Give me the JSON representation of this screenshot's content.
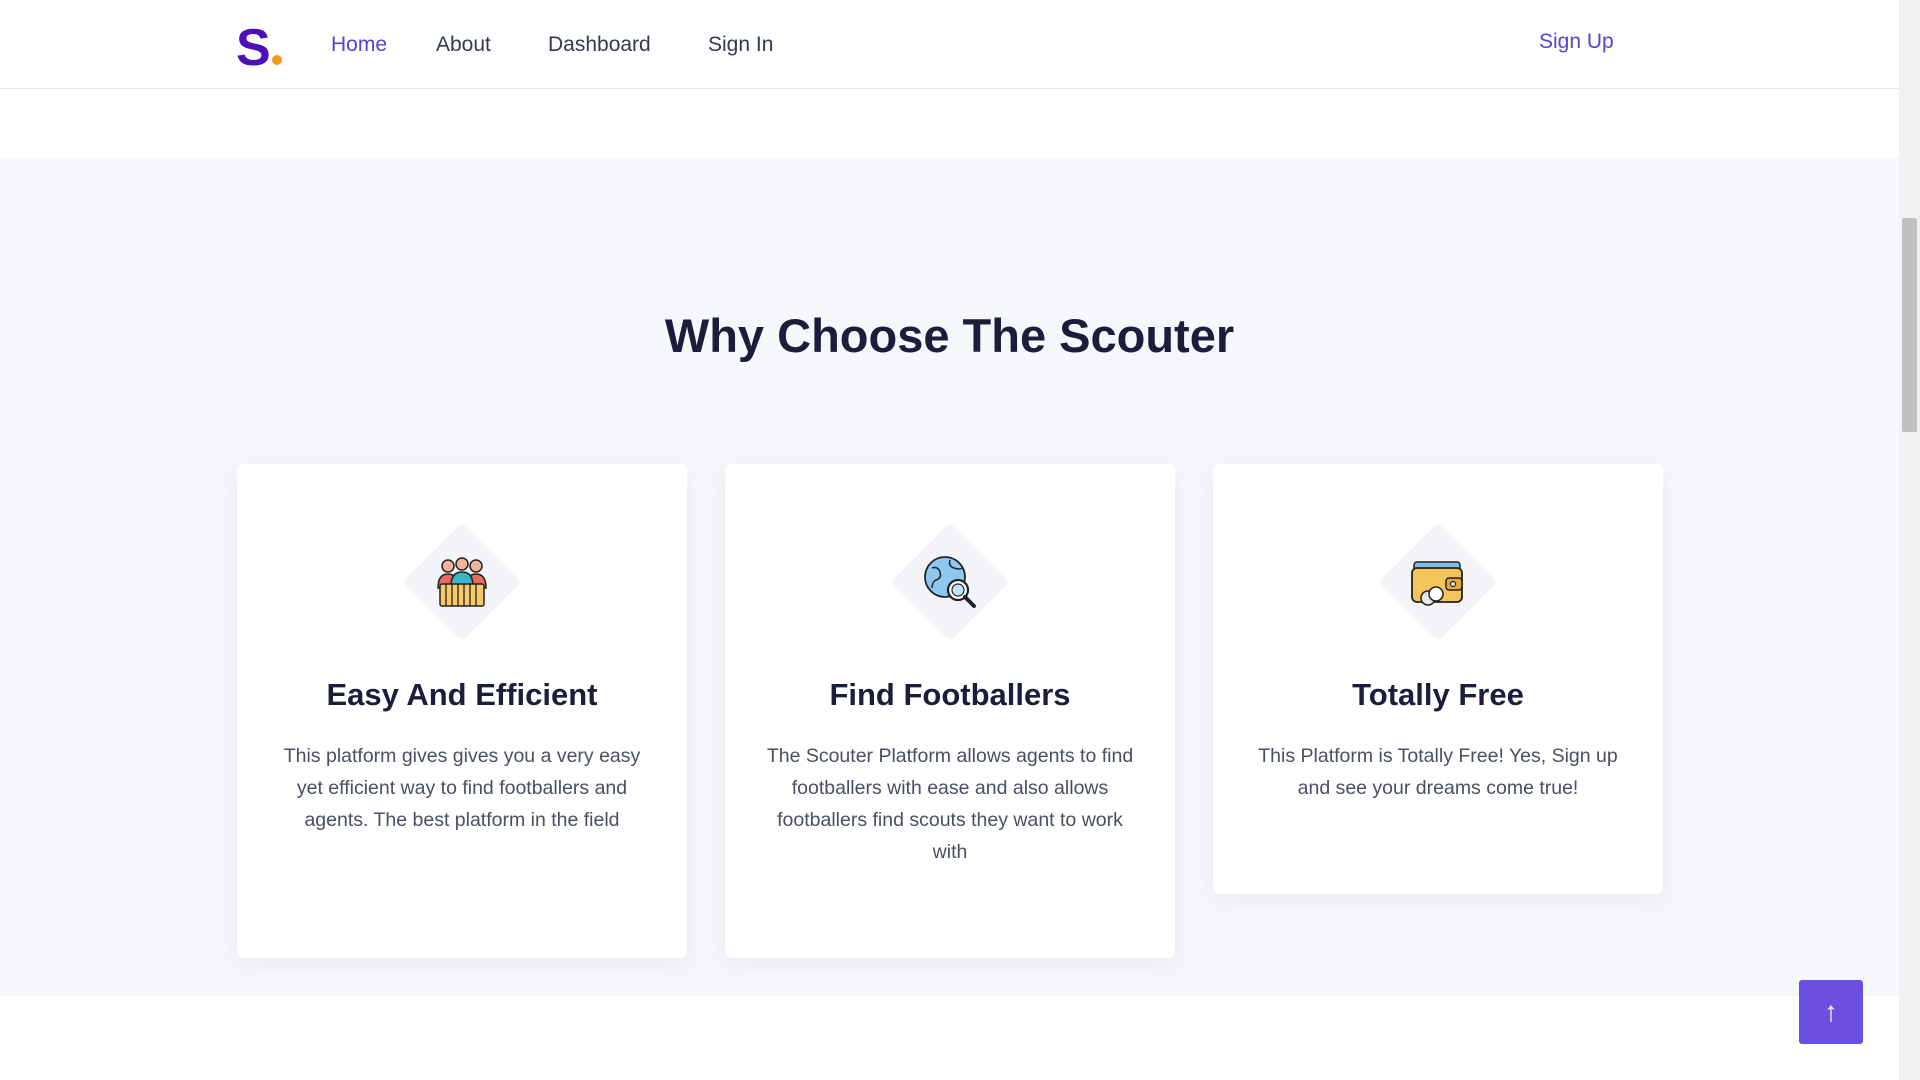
{
  "navbar": {
    "logo_letter": "S",
    "links": [
      {
        "label": "Home",
        "active": true
      },
      {
        "label": "About",
        "active": false
      },
      {
        "label": "Dashboard",
        "active": false
      },
      {
        "label": "Sign In",
        "active": false
      }
    ],
    "signup_label": "Sign Up"
  },
  "features": {
    "title": "Why Choose The Scouter",
    "cards": [
      {
        "icon": "team-players-icon",
        "title": "Easy And Efficient",
        "text": "This platform gives gives you a very easy yet efficient way to find footballers and agents. The best platform in the field"
      },
      {
        "icon": "globe-search-icon",
        "title": "Find Footballers",
        "text": "The Scouter Platform allows agents to find footballers with ease and also allows footballers find scouts they want to work with"
      },
      {
        "icon": "wallet-icon",
        "title": "Totally Free",
        "text": "This Platform is Totally Free! Yes, Sign up and see your dreams come true!"
      }
    ]
  },
  "back_to_top": {
    "icon": "arrow-up-icon",
    "glyph": "↑"
  },
  "colors": {
    "brand": "#4b10b8",
    "accent": "#6a4fe0",
    "logo_dot": "#f29b1b",
    "section_bg": "#f6f7fb"
  }
}
